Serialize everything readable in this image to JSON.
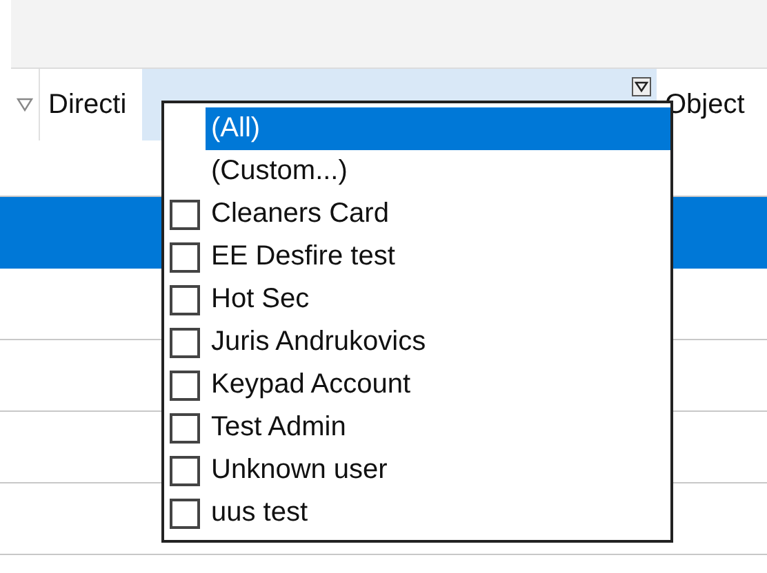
{
  "table": {
    "columns": [
      {
        "label": "Directi",
        "selected": false,
        "filter": false
      },
      {
        "selected": true,
        "filter": true
      },
      {
        "label": "Object",
        "selected": false,
        "filter": false
      }
    ],
    "rows": [
      {
        "selected": false
      },
      {
        "selected": true
      },
      {
        "selected": false
      },
      {
        "selected": false
      },
      {
        "selected": false
      },
      {
        "selected": false
      }
    ]
  },
  "filter_dropdown": {
    "items": [
      {
        "kind": "option",
        "label": "(All)",
        "selected": true
      },
      {
        "kind": "option",
        "label": "(Custom...)",
        "selected": false
      },
      {
        "kind": "checkbox",
        "label": "Cleaners Card",
        "checked": false
      },
      {
        "kind": "checkbox",
        "label": "EE Desfire test",
        "checked": false
      },
      {
        "kind": "checkbox",
        "label": "Hot Sec",
        "checked": false
      },
      {
        "kind": "checkbox",
        "label": "Juris Andrukovics",
        "checked": false
      },
      {
        "kind": "checkbox",
        "label": "Keypad Account",
        "checked": false
      },
      {
        "kind": "checkbox",
        "label": "Test Admin",
        "checked": false
      },
      {
        "kind": "checkbox",
        "label": "Unknown user",
        "checked": false
      },
      {
        "kind": "checkbox",
        "label": "uus test",
        "checked": false
      }
    ]
  }
}
